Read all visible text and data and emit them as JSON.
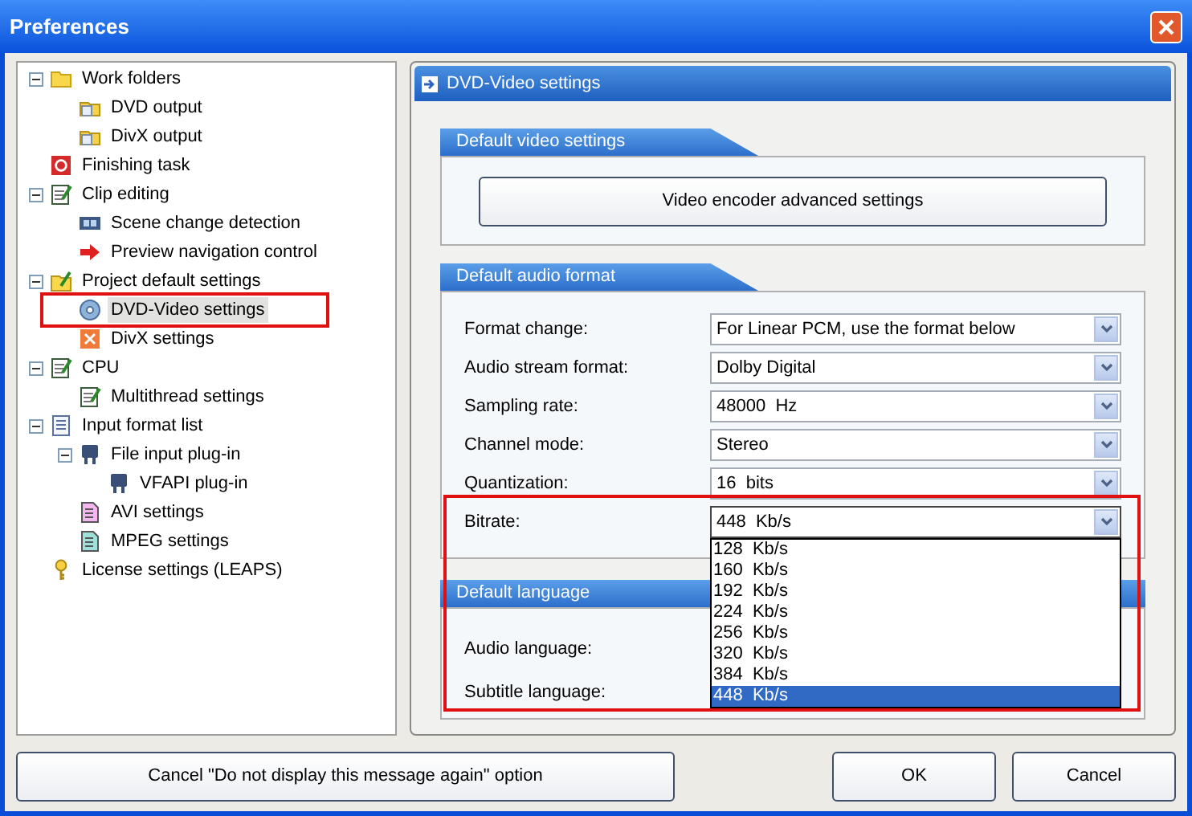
{
  "window": {
    "title": "Preferences"
  },
  "tree": [
    {
      "label": "Work folders",
      "kind": "folder",
      "expanded": true,
      "selected": false,
      "annotated": false,
      "children": [
        {
          "label": "DVD output",
          "kind": "folder-doc",
          "selected": false,
          "annotated": false
        },
        {
          "label": "DivX output",
          "kind": "folder-doc",
          "selected": false,
          "annotated": false
        }
      ]
    },
    {
      "label": "Finishing task",
      "kind": "stop",
      "selected": false,
      "annotated": false
    },
    {
      "label": "Clip editing",
      "kind": "notepad",
      "expanded": true,
      "selected": false,
      "annotated": false,
      "children": [
        {
          "label": "Scene change detection",
          "kind": "film",
          "selected": false,
          "annotated": false
        },
        {
          "label": "Preview navigation control",
          "kind": "arrow",
          "selected": false,
          "annotated": false
        }
      ]
    },
    {
      "label": "Project default settings",
      "kind": "folder-pen",
      "expanded": true,
      "selected": false,
      "annotated": false,
      "children": [
        {
          "label": "DVD-Video settings",
          "kind": "disc",
          "selected": true,
          "annotated": true
        },
        {
          "label": "DivX settings",
          "kind": "cross",
          "selected": false,
          "annotated": false
        }
      ]
    },
    {
      "label": "CPU",
      "kind": "notepad",
      "expanded": true,
      "selected": false,
      "annotated": false,
      "children": [
        {
          "label": "Multithread settings",
          "kind": "notepad",
          "selected": false,
          "annotated": false
        }
      ]
    },
    {
      "label": "Input format list",
      "kind": "list",
      "expanded": true,
      "selected": false,
      "annotated": false,
      "children": [
        {
          "label": "File input plug-in",
          "kind": "plug",
          "expanded": true,
          "selected": false,
          "annotated": false,
          "children": [
            {
              "label": "VFAPI plug-in",
              "kind": "plug",
              "selected": false,
              "annotated": false
            }
          ]
        },
        {
          "label": "AVI settings",
          "kind": "file-pink",
          "selected": false,
          "annotated": false
        },
        {
          "label": "MPEG settings",
          "kind": "file-teal",
          "selected": false,
          "annotated": false
        }
      ]
    },
    {
      "label": "License settings (LEAPS)",
      "kind": "key",
      "selected": false,
      "annotated": false
    }
  ],
  "panel": {
    "title": "DVD-Video settings",
    "video_section": {
      "title": "Default video settings",
      "button": "Video encoder advanced settings"
    },
    "audio_section": {
      "title": "Default audio format",
      "fields": [
        {
          "label": "Format change:",
          "value": "For Linear PCM, use the format below",
          "open": false,
          "annotated": false
        },
        {
          "label": "Audio stream format:",
          "value": "Dolby Digital",
          "open": false,
          "annotated": false
        },
        {
          "label": "Sampling rate:",
          "value": "48000  Hz",
          "open": false,
          "annotated": false
        },
        {
          "label": "Channel mode:",
          "value": "Stereo",
          "open": false,
          "annotated": false
        },
        {
          "label": "Quantization:",
          "value": "16  bits",
          "open": false,
          "annotated": false
        },
        {
          "label": "Bitrate:",
          "value": "448  Kb/s",
          "open": true,
          "annotated": true,
          "options": [
            {
              "label": "128  Kb/s",
              "selected": false
            },
            {
              "label": "160  Kb/s",
              "selected": false
            },
            {
              "label": "192  Kb/s",
              "selected": false
            },
            {
              "label": "224  Kb/s",
              "selected": false
            },
            {
              "label": "256  Kb/s",
              "selected": false
            },
            {
              "label": "320  Kb/s",
              "selected": false
            },
            {
              "label": "384  Kb/s",
              "selected": false
            },
            {
              "label": "448  Kb/s",
              "selected": true
            }
          ]
        }
      ]
    },
    "language_section": {
      "title": "Default language",
      "fields": [
        {
          "label": "Audio language:"
        },
        {
          "label": "Subtitle language:"
        }
      ]
    }
  },
  "buttons": {
    "reset": "Cancel \"Do not display this message again\" option",
    "ok": "OK",
    "cancel": "Cancel"
  }
}
